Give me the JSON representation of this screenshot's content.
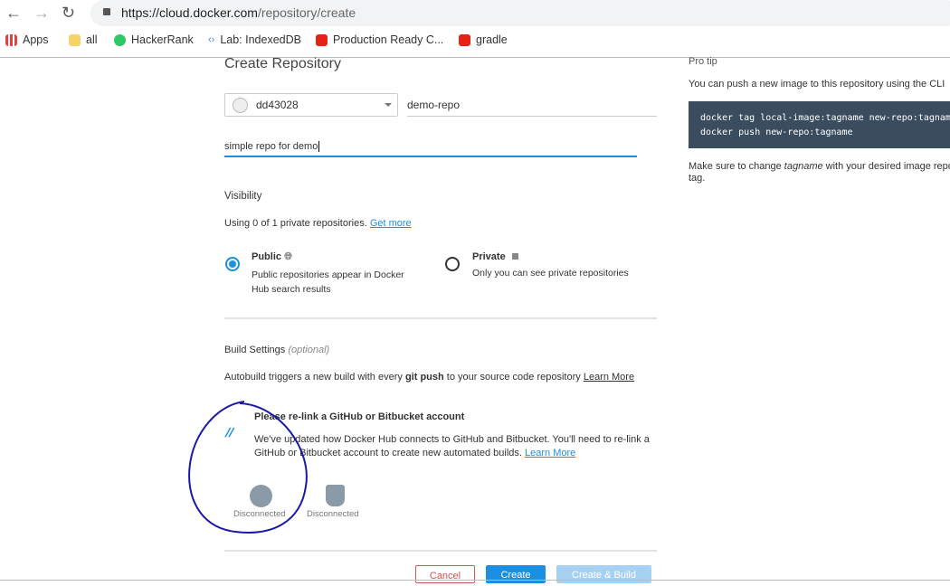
{
  "browser": {
    "url_host": "https://cloud.docker.com",
    "url_path": "/repository/create",
    "bookmarks": [
      {
        "label": "Apps",
        "icon": "apps-grid-icon"
      },
      {
        "label": "all",
        "icon": "folder-icon"
      },
      {
        "label": "HackerRank",
        "icon": "hackerrank-icon"
      },
      {
        "label": "Lab: IndexedDB",
        "icon": "codelabs-icon"
      },
      {
        "label": "Production Ready C...",
        "icon": "youtube-icon"
      },
      {
        "label": "gradle",
        "icon": "youtube-icon"
      }
    ]
  },
  "form": {
    "title": "Create Repository",
    "namespace": "dd43028",
    "repo_name": "demo-repo",
    "description": "simple repo for demo",
    "visibility_heading": "Visibility",
    "usage_text": "Using 0 of 1 private repositories.",
    "get_more": "Get more",
    "public": {
      "label": "Public",
      "desc1": "Public repositories appear in Docker",
      "desc2": "Hub search results",
      "selected": true
    },
    "private": {
      "label": "Private",
      "desc": "Only you can see private repositories",
      "selected": false
    },
    "build_heading": "Build Settings",
    "build_optional": "(optional)",
    "autobuild_pre": "Autobuild triggers a new build with every",
    "autobuild_bold": "git push",
    "autobuild_post": "to your source code repository",
    "learn_more": "Learn More",
    "relink_title": "Please re-link a GitHub or Bitbucket account",
    "relink_text1": "We've updated how Docker Hub connects to GitHub and Bitbucket. You'll need to re-link a",
    "relink_text2": "GitHub or Bitbucket account to create new automated builds.",
    "relink_learn": "Learn More",
    "github_status": "Disconnected",
    "bitbucket_status": "Disconnected",
    "cancel": "Cancel",
    "create": "Create",
    "create_build": "Create & Build"
  },
  "protip": {
    "title": "Pro tip",
    "intro": "You can push a new image to this repository using the CLI",
    "code1": "docker tag local-image:tagname new-repo:tagname",
    "code2": "docker push new-repo:tagname",
    "note_pre": "Make sure to change",
    "note_em": "tagname",
    "note_post": "with your desired image repo",
    "note_line2": "tag."
  },
  "colors": {
    "accent": "#1d8fe0",
    "code_bg": "#394d5f",
    "annotation": "#1a1aa8"
  }
}
